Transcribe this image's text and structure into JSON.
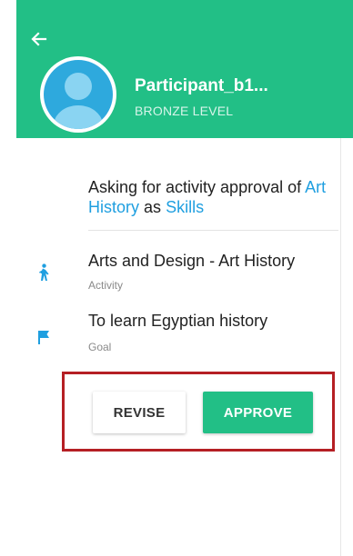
{
  "header": {
    "user_name": "Participant_b1...",
    "user_level": "BRONZE LEVEL",
    "back_icon": "arrow-left-icon",
    "avatar_icon": "user-avatar-icon"
  },
  "request": {
    "prefix": "Asking for activity approval of",
    "activity_link": "Art History",
    "joiner": "as",
    "category_link": "Skills"
  },
  "activity": {
    "title": "Arts and Design - Art History",
    "label": "Activity",
    "icon": "walking-person-icon"
  },
  "goal": {
    "title": "To learn Egyptian history",
    "label": "Goal",
    "icon": "flag-icon"
  },
  "actions": {
    "revise_label": "REVISE",
    "approve_label": "APPROVE"
  },
  "colors": {
    "brand_green": "#22bf86",
    "link_blue": "#1f9fe0",
    "avatar_blue": "#2ea9dd",
    "highlight_red": "#b51f24"
  }
}
